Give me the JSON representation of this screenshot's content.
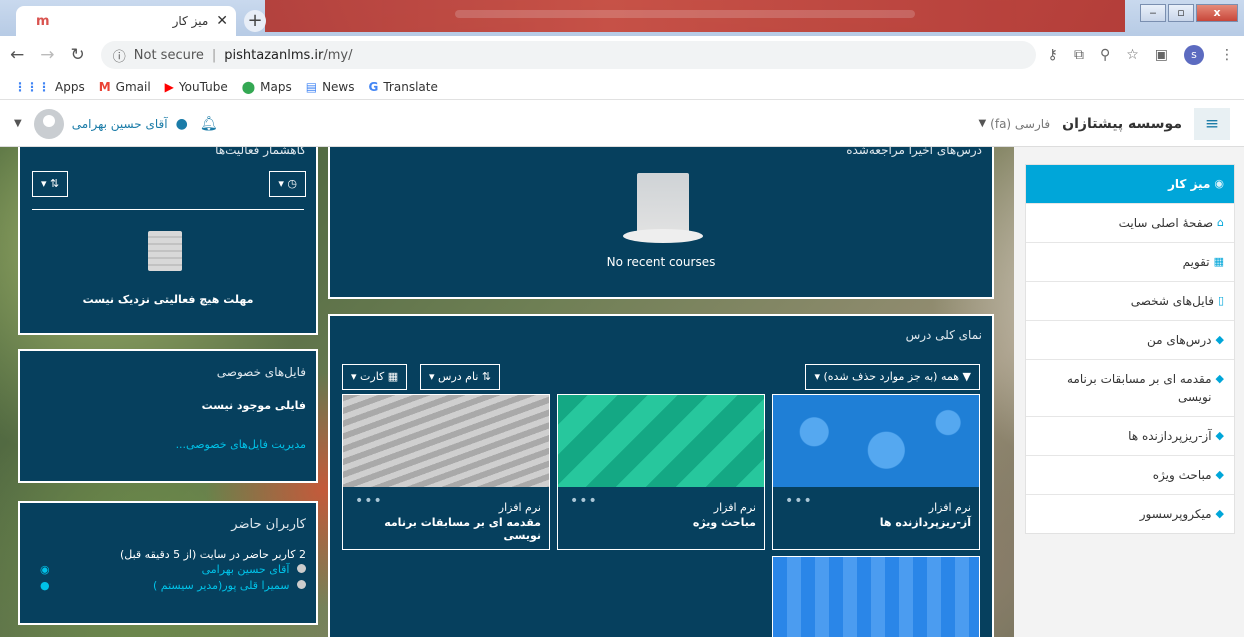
{
  "browser": {
    "tab_title": "میز کار",
    "tab_favicon": "m",
    "new_tab": "+",
    "url_secure_label": "Not secure",
    "url_host": "pishtazanlms.ir",
    "url_path": "/my/",
    "profile_initial": "s",
    "window_buttons": [
      "‒",
      "▫",
      "x"
    ]
  },
  "bookmarks": [
    {
      "label": "Apps",
      "icon": "apps-icon",
      "color": "#4285f4"
    },
    {
      "label": "Gmail",
      "icon": "gmail-icon",
      "color": "#ea4335"
    },
    {
      "label": "YouTube",
      "icon": "youtube-icon",
      "color": "#ff0000"
    },
    {
      "label": "Maps",
      "icon": "maps-icon",
      "color": "#34a853"
    },
    {
      "label": "News",
      "icon": "news-icon",
      "color": "#4285f4"
    },
    {
      "label": "Translate",
      "icon": "translate-icon",
      "color": "#4285f4"
    }
  ],
  "navbar": {
    "brand": "موسسه پیشتازان",
    "language": "فارسی (fa)",
    "user_name": "آقای حسین بهرامی"
  },
  "sidebar": {
    "items": [
      {
        "label": "میز کار",
        "active": true,
        "icon": "dashboard-icon"
      },
      {
        "label": "صفحهٔ اصلی سایت",
        "icon": "home-icon"
      },
      {
        "label": "تقویم",
        "icon": "calendar-icon"
      },
      {
        "label": "فایل‌های شخصی",
        "icon": "file-icon"
      },
      {
        "label": "درس‌های من",
        "icon": "graduation-cap-icon"
      },
      {
        "label": "مقدمه ای بر مسابقات برنامه نویسی",
        "icon": "graduation-cap-icon"
      },
      {
        "label": "آز-ریزپردازنده ها",
        "icon": "graduation-cap-icon"
      },
      {
        "label": "مباحث ویژه",
        "icon": "graduation-cap-icon"
      },
      {
        "label": "میکروپرسسور",
        "icon": "graduation-cap-icon"
      }
    ]
  },
  "recent_courses": {
    "title": "درس‌های اخیراً مراجعه‌شده",
    "empty_text": "No recent courses"
  },
  "course_overview": {
    "title": "نمای کلی درس",
    "filter_label": "همه (به جز موارد حذف شده)",
    "sort_label": "نام درس",
    "view_label": "کارت",
    "courses": [
      {
        "category": "نرم افزار",
        "name": "آز-ریزپردازنده ها",
        "bg": "#1f7fd6"
      },
      {
        "category": "نرم افزار",
        "name": "مباحث ویژه",
        "bg": "#1bb38f"
      },
      {
        "category": "نرم افزار",
        "name": "مقدمه ای بر مسابقات برنامه نویسی",
        "bg": "#b4b4b4"
      },
      {
        "bg": "#2a86e8"
      }
    ],
    "more": "•••"
  },
  "timeline": {
    "title": "گاهشمار فعالیت‌ها",
    "empty_text": "مهلت هیچ فعالیتی نزدیک نیست"
  },
  "private_files": {
    "title": "فایل‌های خصوصی",
    "empty_text": "فایلی موجود نیست",
    "manage_link": "مدیریت فایل‌های خصوصی..."
  },
  "online_users": {
    "title": "کاربران حاضر",
    "summary": "2 کاربر حاضر در سایت (از 5 دقیقه قبل)",
    "users": [
      "آقای حسین بهرامی",
      "سمیرا قلی پور(مدیر سیستم )"
    ]
  }
}
